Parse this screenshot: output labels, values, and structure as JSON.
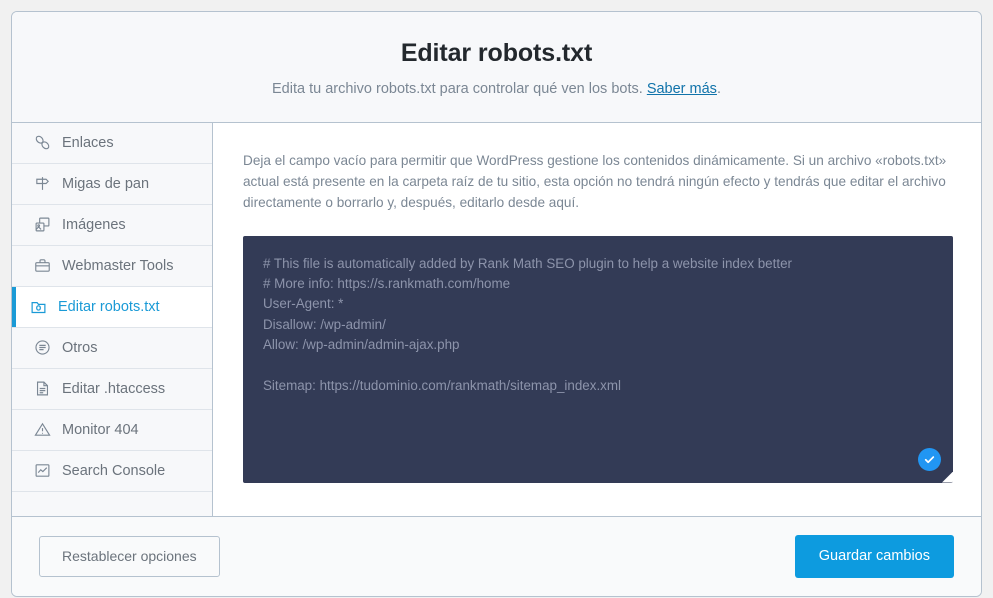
{
  "header": {
    "title": "Editar robots.txt",
    "subtitle_before": "Edita tu archivo robots.txt para controlar qué ven los bots. ",
    "link_label": "Saber más",
    "subtitle_after": "."
  },
  "sidebar": {
    "items": [
      {
        "label": "Enlaces",
        "icon": "link-icon",
        "active": false
      },
      {
        "label": "Migas de pan",
        "icon": "signpost-icon",
        "active": false
      },
      {
        "label": "Imágenes",
        "icon": "images-icon",
        "active": false
      },
      {
        "label": "Webmaster Tools",
        "icon": "briefcase-icon",
        "active": false
      },
      {
        "label": "Editar robots.txt",
        "icon": "robots-file-icon",
        "active": true
      },
      {
        "label": "Otros",
        "icon": "circle-lines-icon",
        "active": false
      },
      {
        "label": "Editar .htaccess",
        "icon": "document-icon",
        "active": false
      },
      {
        "label": "Monitor 404",
        "icon": "warning-triangle-icon",
        "active": false
      },
      {
        "label": "Search Console",
        "icon": "line-chart-icon",
        "active": false
      }
    ]
  },
  "content": {
    "description": "Deja el campo vacío para permitir que WordPress gestione los contenidos dinámicamente. Si un archivo «robots.txt» actual está presente en la carpeta raíz de tu sitio, esta opción no tendrá ningún efecto y tendrás que editar el archivo directamente o borrarlo y, después, editarlo desde aquí.",
    "editor": {
      "value": "# This file is automatically added by Rank Math SEO plugin to help a website index better\n# More info: https://s.rankmath.com/home\nUser-Agent: *\nDisallow: /wp-admin/\nAllow: /wp-admin/admin-ajax.php\n\nSitemap: https://tudominio.com/rankmath/sitemap_index.xml",
      "status_badge": "valid-check-icon"
    }
  },
  "footer": {
    "reset_label": "Restablecer opciones",
    "save_label": "Guardar cambios"
  },
  "colors": {
    "accent_blue": "#1a9ad6",
    "primary_button": "#0d9bdf",
    "link_blue": "#1073aa",
    "editor_bg": "#333b56",
    "editor_text": "#8d94ab",
    "badge_blue": "#2196f3",
    "page_bg": "#f1f1f1",
    "panel_bg": "#f7f8fa",
    "border": "#b5c2cf"
  }
}
